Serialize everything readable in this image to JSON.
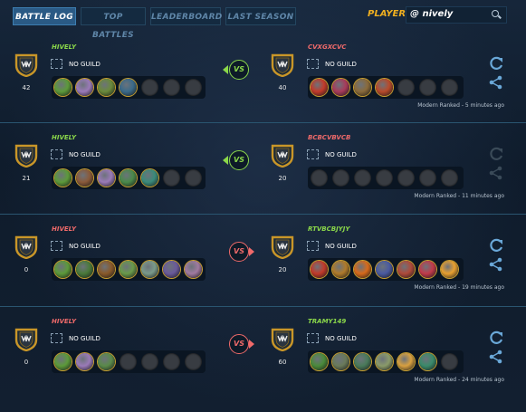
{
  "tabs": [
    {
      "label": "BATTLE LOG",
      "active": true
    },
    {
      "label": "TOP BATTLES",
      "active": false
    },
    {
      "label": "LEADERBOARD",
      "active": false
    },
    {
      "label": "LAST SEASON",
      "active": false
    }
  ],
  "player": {
    "label": "PLAYER:",
    "value": "@ nively"
  },
  "colors": {
    "win": "#8bd84a",
    "lose": "#f06a6a",
    "gold": "#f0b020",
    "accent": "#2a5a85"
  },
  "battles": [
    {
      "left": {
        "name": "HIVELY",
        "result": "win",
        "guild": "NO GUILD",
        "rating": "42",
        "cards": [
          "#5c9a3a",
          "#9a7ab8",
          "#6a8a3a",
          "#3a6a8a",
          "",
          "",
          ""
        ]
      },
      "vs": "VS",
      "vs_result": "win",
      "right": {
        "name": "CVXGXCVC",
        "result": "lose",
        "guild": "NO GUILD",
        "rating": "40",
        "cards": [
          "#c23a2a",
          "#a83a5a",
          "#8a6a3a",
          "#b84a2a",
          "",
          "",
          ""
        ]
      },
      "meta": "Modern Ranked - 5 minutes ago",
      "actions_active": true
    },
    {
      "left": {
        "name": "HIVELY",
        "result": "win",
        "guild": "NO GUILD",
        "rating": "21",
        "cards": [
          "#5c9a3a",
          "#8a5a3a",
          "#9a7ab8",
          "#4a8a4a",
          "#3a8a7a",
          "",
          ""
        ]
      },
      "vs": "VS",
      "vs_result": "win",
      "right": {
        "name": "BCBCVBVCB",
        "result": "lose",
        "guild": "NO GUILD",
        "rating": "20",
        "cards": [
          "",
          "",
          "",
          "",
          "",
          "",
          ""
        ]
      },
      "meta": "Modern Ranked - 11 minutes ago",
      "actions_active": false
    },
    {
      "left": {
        "name": "HIVELY",
        "result": "lose",
        "guild": "NO GUILD",
        "rating": "0",
        "cards": [
          "#5c9a3a",
          "#4a7a3a",
          "#8a5a2a",
          "#6a9a4a",
          "#7a9a8a",
          "#6a5a9a",
          "#a07aa0"
        ]
      },
      "vs": "VS",
      "vs_result": "lose",
      "right": {
        "name": "RTVBCBJYJY",
        "result": "win",
        "guild": "NO GUILD",
        "rating": "20",
        "cards": [
          "#c23a2a",
          "#b07a2a",
          "#d86a1a",
          "#4a5aa0",
          "#b04a3a",
          "#c23a4a",
          "#e8a030"
        ]
      },
      "meta": "Modern Ranked - 19 minutes ago",
      "actions_active": true
    },
    {
      "left": {
        "name": "HIVELY",
        "result": "lose",
        "guild": "NO GUILD",
        "rating": "0",
        "cards": [
          "#5c9a3a",
          "#9a7ab8",
          "#5a8a4a",
          "",
          "",
          "",
          ""
        ]
      },
      "vs": "VS",
      "vs_result": "lose",
      "right": {
        "name": "TRAMY149",
        "result": "win",
        "guild": "NO GUILD",
        "rating": "60",
        "cards": [
          "#4a8a3a",
          "#6a7a5a",
          "#4a7a5a",
          "#8a9a6a",
          "#d8a040",
          "#3a8a6a",
          ""
        ]
      },
      "meta": "Modern Ranked - 24 minutes ago",
      "actions_active": true
    }
  ]
}
